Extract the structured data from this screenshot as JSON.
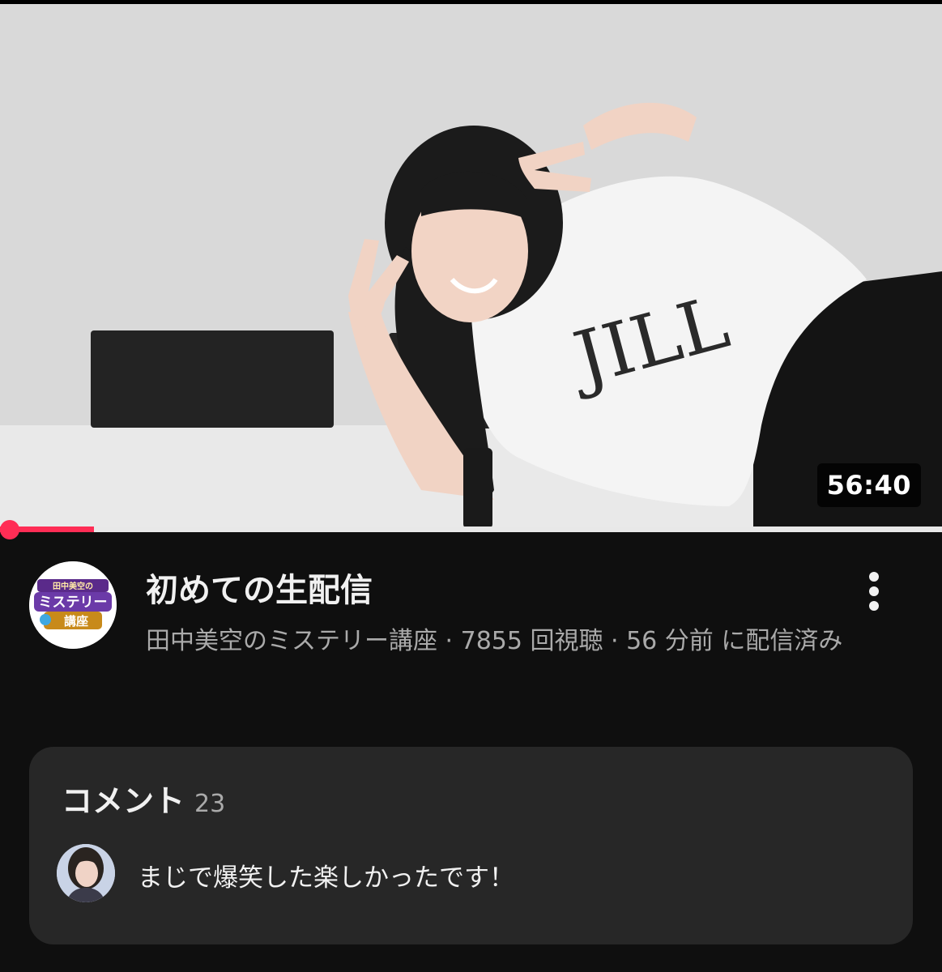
{
  "video": {
    "duration": "56:40",
    "progress_fraction": 0.1,
    "title": "初めての生配信",
    "meta": "田中美空のミステリー講座 · 7855 回視聴 · 56 分前 に配信済み"
  },
  "channel": {
    "logo_text_top": "田中美空の",
    "logo_text_main": "ミステリー",
    "logo_text_bottom": "講座"
  },
  "comments": {
    "title": "コメント",
    "count": "23",
    "top_comment": "まじで爆笑した楽しかったです！"
  },
  "colors": {
    "background": "#0f0f0f",
    "card": "#272727",
    "accent": "#ff2d55",
    "text_primary": "#f1f1f1",
    "text_secondary": "#aaaaaa"
  },
  "icons": [
    "more-vertical-icon"
  ]
}
